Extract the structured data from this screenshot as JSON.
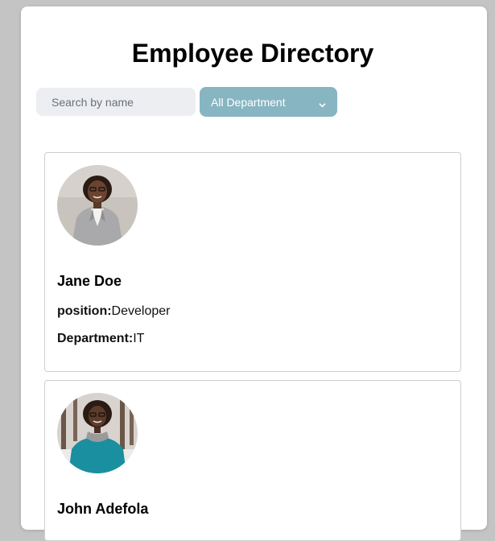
{
  "header": {
    "title": "Employee Directory"
  },
  "search": {
    "placeholder": "Search by name",
    "value": ""
  },
  "department_filter": {
    "selected": "All Department",
    "icon": "chevron-down-icon"
  },
  "employees": [
    {
      "name": "Jane Doe",
      "position_label": "position:",
      "position": "Developer",
      "department_label": "Department:",
      "department": "IT"
    },
    {
      "name": "John Adefola"
    }
  ],
  "colors": {
    "filter_bg": "#87b5c2",
    "search_bg": "#eceef1",
    "page_bg": "#c4c4c4"
  }
}
